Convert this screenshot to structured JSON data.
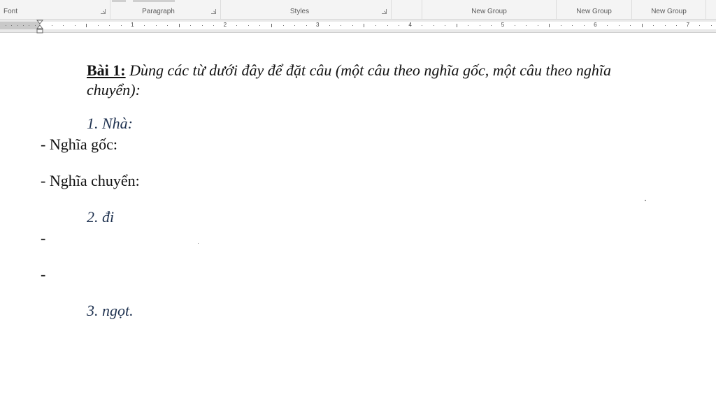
{
  "ribbon": {
    "groups": {
      "font": "Font",
      "paragraph": "Paragraph",
      "styles": "Styles",
      "new_group_1": "New Group",
      "new_group_2": "New Group",
      "new_group_3": "New Group"
    }
  },
  "ruler": {
    "numbers": [
      "1",
      "2",
      "3",
      "4",
      "5",
      "6",
      "7"
    ]
  },
  "document": {
    "title_label": "Bài 1:",
    "title_text_line1": " Dùng các từ dưới đây để đặt câu (một câu theo nghĩa gốc, một câu theo nghĩa",
    "title_text_line2": "chuyển):",
    "item1_heading": "1. Nhà:",
    "item1_literal": "- Nghĩa gốc:",
    "item1_figurative": "- Nghĩa chuyển:",
    "item2_heading": "2. đi",
    "item2_dash1": "-",
    "item2_dash2": "-",
    "item3_heading": "3.  ngọt."
  },
  "colors": {
    "ribbon_bg": "#f4f4f4",
    "ruler_bg": "#e9e9e9",
    "heading_text": "#1f3250",
    "body_text": "#111111"
  },
  "icons": [
    "dialog-launcher-icon",
    "indent-marker-icon"
  ]
}
